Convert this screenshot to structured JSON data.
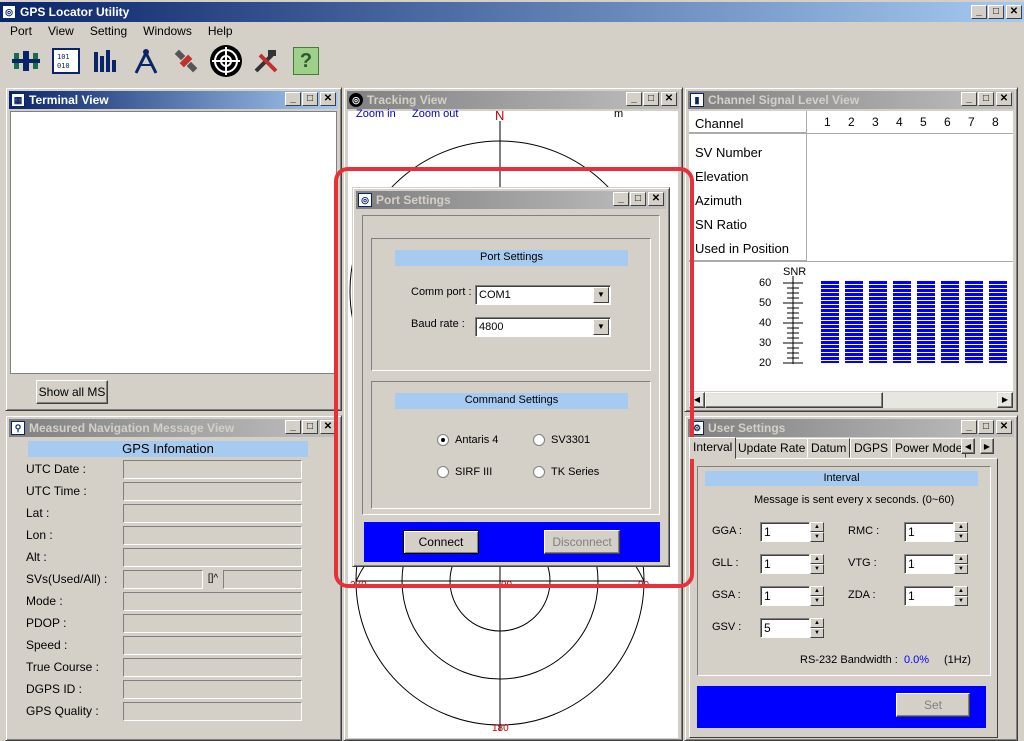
{
  "app": {
    "title": "GPS Locator Utility"
  },
  "menu": [
    "Port",
    "View",
    "Setting",
    "Windows",
    "Help"
  ],
  "toolbar": {
    "icons": [
      "port-icon",
      "terminal-icon",
      "signal-icon",
      "compass-icon",
      "satellite-icon",
      "tracking-icon",
      "tools-icon",
      "help-icon"
    ],
    "help_glyph": "?"
  },
  "terminal": {
    "title": "Terminal View",
    "show_all": "Show all MS"
  },
  "tracking": {
    "title": "Tracking View",
    "zoom_in": "Zoom in",
    "zoom_out": "Zoom out",
    "unit": "m",
    "north": "N",
    "west": "270",
    "center": "90",
    "east": "90",
    "south": "180"
  },
  "signal": {
    "title": "Channel Signal Level View",
    "channel_label": "Channel",
    "channels": [
      "1",
      "2",
      "3",
      "4",
      "5",
      "6",
      "7",
      "8"
    ],
    "rows": [
      "SV Number",
      "Elevation",
      "Azimuth",
      "SN Ratio",
      "Used in Position"
    ],
    "snr_label": "SNR",
    "snr_ticks": [
      "60",
      "50",
      "40",
      "30",
      "20"
    ],
    "bar_color": "#0000ff"
  },
  "nav": {
    "title": "Measured Navigation Message View",
    "header": "GPS Infomation",
    "fields": [
      "UTC Date :",
      "UTC Time :",
      "Lat :",
      "Lon :",
      "Alt :",
      "SVs(Used/All) :",
      "Mode :",
      "PDOP :",
      "Speed :",
      "True Course :",
      "DGPS ID :",
      "GPS Quality :"
    ],
    "svs_marker": "[]^"
  },
  "user": {
    "title": "User Settings",
    "tabs": [
      "Interval",
      "Update Rate",
      "Datum",
      "DGPS",
      "Power Mode"
    ],
    "group": "Interval",
    "message": "Message is sent every x seconds. (0~60)",
    "left": [
      {
        "label": "GGA :",
        "value": "1"
      },
      {
        "label": "GLL :",
        "value": "1"
      },
      {
        "label": "GSA :",
        "value": "1"
      },
      {
        "label": "GSV :",
        "value": "5"
      }
    ],
    "right": [
      {
        "label": "RMC :",
        "value": "1"
      },
      {
        "label": "VTG :",
        "value": "1"
      },
      {
        "label": "ZDA :",
        "value": "1"
      }
    ],
    "bandwidth_label": "RS-232 Bandwidth :",
    "bandwidth_value": "0.0%",
    "bandwidth_hz": "(1Hz)",
    "set": "Set"
  },
  "dialog": {
    "title": "Port Settings",
    "group1": "Port Settings",
    "comm_label": "Comm port :",
    "comm_value": "COM1",
    "baud_label": "Baud rate :",
    "baud_value": "4800",
    "group2": "Command Settings",
    "radios": [
      {
        "label": "Antaris 4",
        "selected": true
      },
      {
        "label": "SV3301",
        "selected": false
      },
      {
        "label": "SIRF III",
        "selected": false
      },
      {
        "label": "TK Series",
        "selected": false
      }
    ],
    "connect": "Connect",
    "disconnect": "Disconnect"
  },
  "colors": {
    "highlight": "#e8303a",
    "accent_blue": "#0000ff",
    "title_active": "#0a246a"
  }
}
